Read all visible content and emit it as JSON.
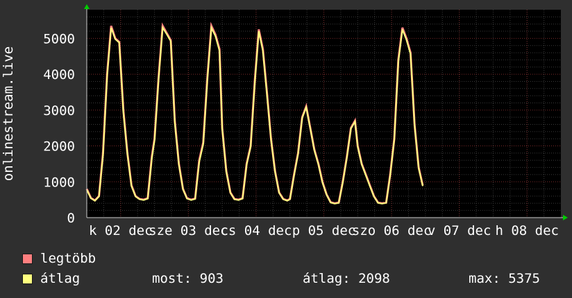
{
  "chart_data": {
    "type": "line",
    "ylabel": "onlinestream.live",
    "ylim": [
      0,
      5800
    ],
    "yticks": [
      0,
      1000,
      2000,
      3000,
      4000,
      5000
    ],
    "xlabels": [
      "k 02 dec",
      "sze 03 dec",
      "cs 04 dec",
      "p 05 dec",
      "szo 06 dec",
      "v 07 dec",
      "h 08 dec"
    ],
    "x": [
      0,
      0.06,
      0.12,
      0.18,
      0.24,
      0.3,
      0.36,
      0.42,
      0.48,
      0.54,
      0.6,
      0.66,
      0.72,
      0.78,
      0.84,
      0.9,
      0.96,
      1,
      1.06,
      1.12,
      1.18,
      1.24,
      1.3,
      1.36,
      1.42,
      1.48,
      1.54,
      1.6,
      1.66,
      1.72,
      1.78,
      1.84,
      1.9,
      1.96,
      2,
      2.06,
      2.12,
      2.18,
      2.24,
      2.3,
      2.36,
      2.42,
      2.48,
      2.54,
      2.6,
      2.66,
      2.72,
      2.78,
      2.84,
      2.9,
      2.96,
      3,
      3.06,
      3.12,
      3.18,
      3.24,
      3.3,
      3.36,
      3.42,
      3.48,
      3.54,
      3.6,
      3.66,
      3.72,
      3.78,
      3.84,
      3.9,
      3.96,
      4,
      4.06,
      4.12,
      4.18,
      4.24,
      4.3,
      4.36,
      4.42,
      4.48,
      4.54,
      4.6,
      4.66,
      4.72,
      4.78,
      4.84,
      4.9,
      4.96,
      5,
      5.06,
      5.12,
      5.18,
      5.24,
      5.3,
      5.36,
      5.42,
      5.48,
      5.54,
      5.6,
      5.66,
      5.72,
      5.78,
      5.84,
      5.9,
      5.96,
      6,
      6.06,
      6.12,
      6.18,
      6.24,
      6.3,
      6.36,
      6.42,
      6.48,
      6.54,
      6.6,
      6.66,
      6.72,
      6.78,
      6.84,
      6.9,
      6.96
    ],
    "series": [
      {
        "name": "legtöbb",
        "color": "#ff7f7f",
        "values": [
          800,
          550,
          480,
          600,
          1800,
          4000,
          5350,
          5000,
          4900,
          3000,
          1800,
          900,
          600,
          520,
          500,
          540,
          1700,
          2200,
          3900,
          5350,
          5150,
          4950,
          2700,
          1500,
          800,
          540,
          500,
          530,
          1600,
          2100,
          3900,
          5350,
          5100,
          4700,
          2500,
          1300,
          700,
          520,
          500,
          540,
          1500,
          2000,
          3800,
          5250,
          4700,
          3500,
          2200,
          1300,
          700,
          520,
          480,
          520,
          1200,
          1800,
          2800,
          3100,
          2500,
          1900,
          1500,
          1000,
          650,
          430,
          400,
          420,
          1000,
          1700,
          2500,
          2700,
          2000,
          1500,
          1200,
          900,
          600,
          420,
          400,
          420,
          1200,
          2200,
          4400,
          5300,
          5000,
          4600,
          2600,
          1400,
          900
        ]
      },
      {
        "name": "átlag",
        "color": "#ffff7f",
        "values": [
          780,
          540,
          470,
          590,
          1750,
          3950,
          5300,
          4980,
          4880,
          2950,
          1780,
          880,
          590,
          510,
          490,
          530,
          1650,
          2150,
          3850,
          5300,
          5120,
          4920,
          2650,
          1480,
          790,
          530,
          490,
          520,
          1550,
          2050,
          3850,
          5300,
          5060,
          4650,
          2480,
          1280,
          690,
          510,
          490,
          530,
          1480,
          1980,
          3750,
          5200,
          4650,
          3450,
          2180,
          1280,
          690,
          510,
          470,
          510,
          1180,
          1780,
          2780,
          3080,
          2480,
          1880,
          1480,
          980,
          640,
          420,
          390,
          410,
          980,
          1680,
          2480,
          2680,
          1980,
          1480,
          1180,
          880,
          590,
          410,
          390,
          410,
          1180,
          2180,
          4350,
          5250,
          4960,
          4560,
          2580,
          1380,
          880
        ]
      }
    ],
    "grid": true
  },
  "legend": {
    "max_label": "legtöbb",
    "avg_label": "átlag",
    "most": "most: 903",
    "atlag": "átlag: 2098",
    "max": "max: 5375"
  }
}
